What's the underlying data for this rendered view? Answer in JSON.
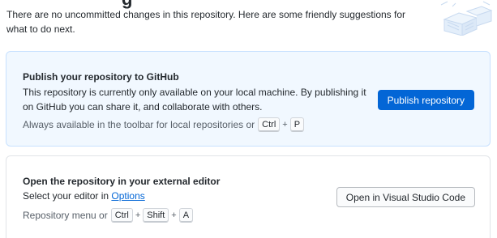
{
  "intro_text": "There are no uncommitted changes in this repository. Here are some friendly suggestions for what to do next.",
  "publish_card": {
    "title": "Publish your repository to GitHub",
    "description": "This repository is currently only available on your local machine. By publishing it on GitHub you can share it, and collaborate with others.",
    "hint_prefix": "Always available in the toolbar for local repositories or",
    "shortcut_keys": [
      "Ctrl",
      "P"
    ],
    "button_label": "Publish repository"
  },
  "editor_card": {
    "title": "Open the repository in your external editor",
    "description_prefix": "Select your editor in",
    "options_link": "Options",
    "hint_prefix": "Repository menu or",
    "shortcut_keys": [
      "Ctrl",
      "Shift",
      "A"
    ],
    "button_label": "Open in Visual Studio Code"
  },
  "colors": {
    "accent": "#0366d6",
    "highlight_bg": "#f1f8ff"
  },
  "icons": {
    "illustration": "empty-state-illustration"
  }
}
